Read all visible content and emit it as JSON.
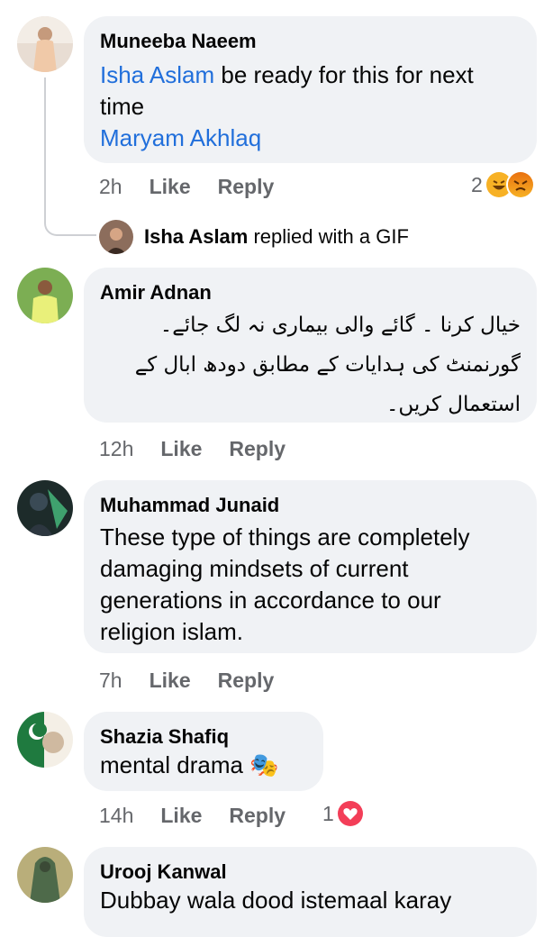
{
  "comments": [
    {
      "author": "Muneeba Naeem",
      "mention1": "Isha Aslam",
      "text1": " be ready for this for next time",
      "mention2": "Maryam Akhlaq",
      "time": "2h",
      "like": "Like",
      "reply": "Reply",
      "reaction_count": "2",
      "reactions": [
        "laugh-emoji",
        "angry-emoji"
      ]
    },
    {
      "author": "Amir Adnan",
      "text": "خیال کرنا ۔ گائے والی بیماری نہ لگ جائے۔ گورنمنٹ کی ہدایات کے مطابق دودھ ابال کے استعمال کریں۔",
      "time": "12h",
      "like": "Like",
      "reply": "Reply"
    },
    {
      "author": "Muhammad Junaid",
      "text": "These type of things are completely damaging mindsets of current generations in accordance to our religion islam.",
      "time": "7h",
      "like": "Like",
      "reply": "Reply"
    },
    {
      "author": "Shazia Shafiq",
      "text": "mental drama 🎭",
      "time": "14h",
      "like": "Like",
      "reply": "Reply",
      "reaction_count": "1",
      "reactions": [
        "love-emoji"
      ]
    },
    {
      "author": "Urooj Kanwal",
      "text": "Dubbay wala dood istemaal karay"
    }
  ],
  "gif_reply": {
    "author": "Isha Aslam",
    "text": "replied with a GIF"
  },
  "colors": {
    "bubble": "#f0f2f5",
    "mention": "#216fdb",
    "meta": "#65676b",
    "love": "#f33e58",
    "haha": "#f7b125",
    "angry": "#e9710f"
  }
}
